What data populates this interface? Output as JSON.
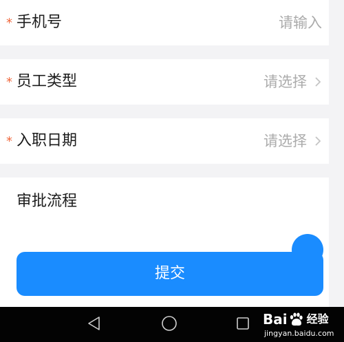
{
  "form": {
    "fields": [
      {
        "required_mark": "*",
        "label": "手机号",
        "placeholder": "请输入"
      },
      {
        "required_mark": "*",
        "label": "员工类型",
        "placeholder": "请选择"
      },
      {
        "required_mark": "*",
        "label": "入职日期",
        "placeholder": "请选择"
      }
    ]
  },
  "approval": {
    "title": "审批流程"
  },
  "submit_button": {
    "label": "提交"
  },
  "nav_bar": {
    "buttons": [
      "back-icon",
      "home-icon",
      "recent-apps-icon"
    ]
  },
  "watermark": {
    "brand_left": "Bai",
    "brand_right": "经验",
    "url": "jingyan.baidu.com"
  },
  "colors": {
    "accent": "#1a8cff",
    "required": "#f0683d",
    "placeholder": "#ababab",
    "background": "#f3f3f5",
    "nav_bar": "#030303"
  }
}
